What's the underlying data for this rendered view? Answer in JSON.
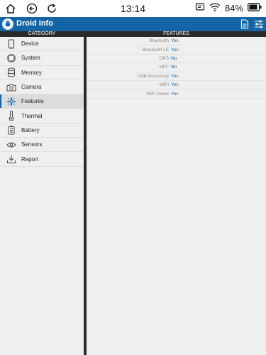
{
  "status_bar": {
    "time": "13:14",
    "battery": "84%",
    "icons": [
      "home-icon",
      "back-icon",
      "refresh-icon",
      "message-icon",
      "wifi-icon",
      "battery-icon"
    ]
  },
  "app_bar": {
    "title": "Droid Info",
    "actions": [
      "report-icon",
      "settings-sliders-icon"
    ]
  },
  "headers": {
    "category": "CATEGORY",
    "features": "FEATURES"
  },
  "sidebar": {
    "selected": "Features",
    "items": [
      {
        "label": "Device",
        "icon": "phone-icon"
      },
      {
        "label": "System",
        "icon": "chip-icon"
      },
      {
        "label": "Memory",
        "icon": "database-icon"
      },
      {
        "label": "Camera",
        "icon": "camera-icon"
      },
      {
        "label": "Features",
        "icon": "sparkle-icon"
      },
      {
        "label": "Thermal",
        "icon": "thermometer-icon"
      },
      {
        "label": "Battery",
        "icon": "battery-icon"
      },
      {
        "label": "Sensors",
        "icon": "eye-icon"
      },
      {
        "label": "Report",
        "icon": "download-icon"
      }
    ]
  },
  "features": [
    {
      "name": "Bluetooth",
      "value": "Yes"
    },
    {
      "name": "Bluetooth LE",
      "value": "Yes"
    },
    {
      "name": "GPS",
      "value": "No"
    },
    {
      "name": "NFC",
      "value": "No"
    },
    {
      "name": "USB Accessory",
      "value": "Yes"
    },
    {
      "name": "WiFi",
      "value": "Yes"
    },
    {
      "name": "WiFi Direct",
      "value": "Yes"
    }
  ],
  "colors": {
    "accent": "#1565a6",
    "header_bg": "#2b2b2b",
    "panel_bg": "#efefef"
  }
}
